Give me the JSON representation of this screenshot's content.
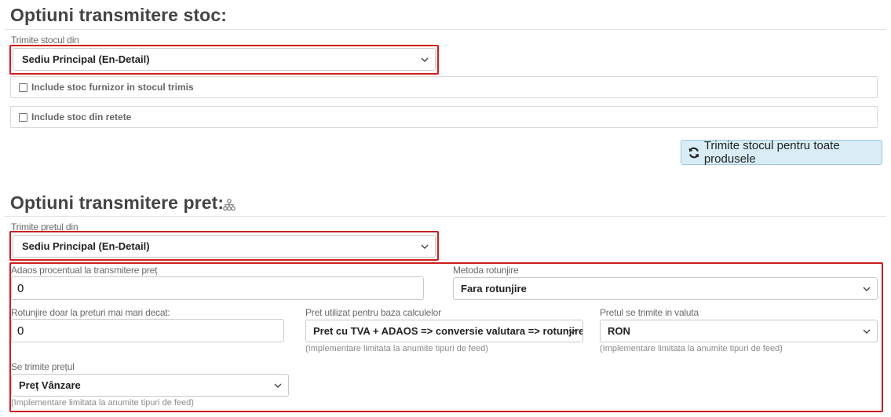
{
  "stock": {
    "title": "Optiuni transmitere stoc:",
    "source_label": "Trimite stocul din",
    "source_value": "Sediu Principal (En-Detail)",
    "include_supplier_label": "Include stoc furnizor in stocul trimis",
    "include_supplier_checked": false,
    "include_recipes_label": "Include stoc din retete",
    "include_recipes_checked": false,
    "send_all_button": "Trimite stocul pentru toate produsele",
    "send_all_icon": "refresh-icon"
  },
  "price": {
    "title": "Optiuni transmitere pret:",
    "title_icon": "sitemap-icon",
    "source_label": "Trimite pretul din",
    "source_value": "Sediu Principal (En-Detail)",
    "markup_label": "Adaos procentual la transmitere preț",
    "markup_value": "0",
    "rounding_method_label": "Metoda rotunjire",
    "rounding_method_value": "Fara rotunjire",
    "round_above_label": "Rotunjire doar la preturi mai mari decat:",
    "round_above_value": "0",
    "base_price_label": "Pret utilizat pentru baza calculelor",
    "base_price_value": "Pret cu TVA + ADAOS => conversie valutara => rotunjire",
    "base_price_hint": "(Implementare limitata la anumite tipuri de feed)",
    "currency_label": "Pretul se trimite in valuta",
    "currency_value": "RON",
    "currency_hint": "(Implementare limitata la anumite tipuri de feed)",
    "price_type_label": "Se trimite prețul",
    "price_type_value": "Preț Vânzare",
    "price_type_hint": "(Implementare limitata la anumite tipuri de feed)"
  },
  "colors": {
    "highlight_border": "#cc1f1f",
    "button_bg": "#d9edf7",
    "button_border": "#9ec7dd"
  }
}
